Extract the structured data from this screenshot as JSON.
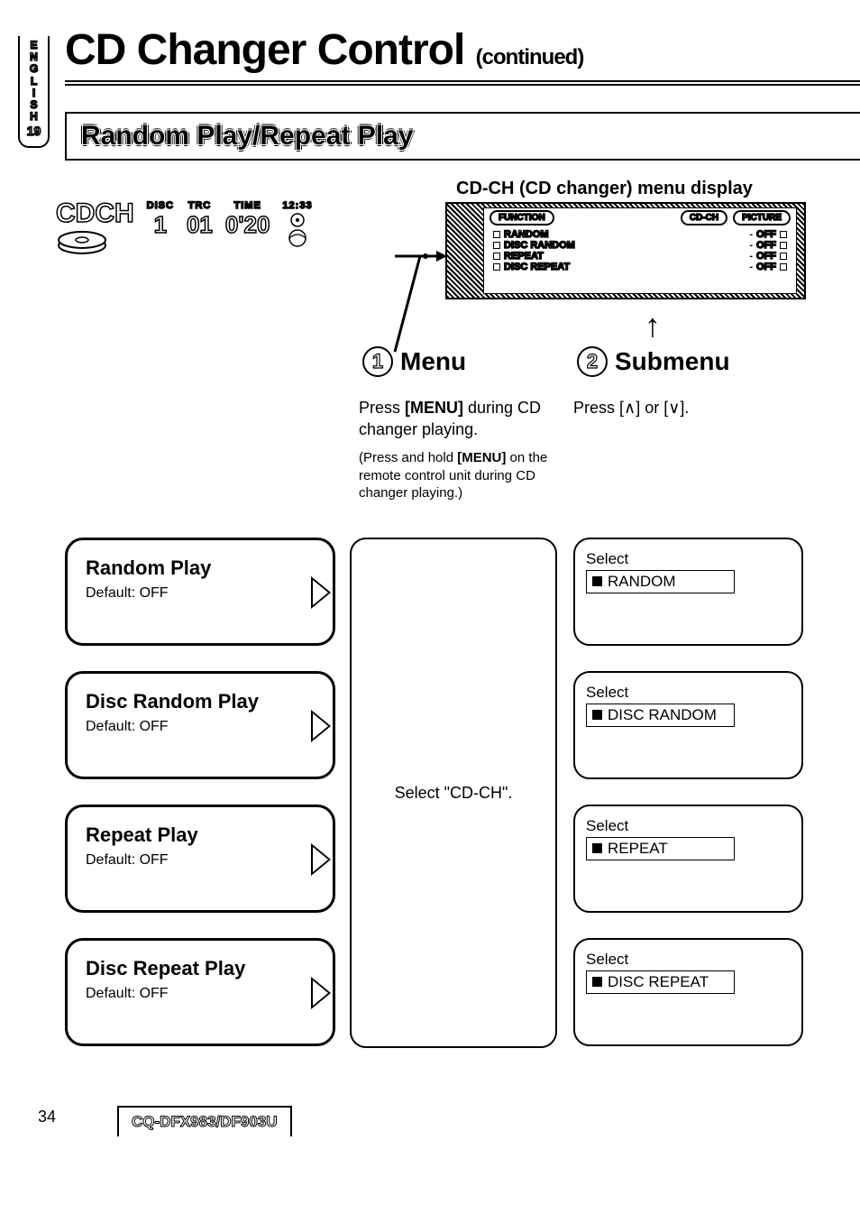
{
  "sidebar": {
    "language": "ENGLISH",
    "page_tab": "19"
  },
  "title": {
    "main": "CD Changer Control",
    "suffix": "(continued)"
  },
  "section": "Random Play/Repeat Play",
  "display": {
    "source": "CDCH",
    "disc_label": "DISC",
    "disc_value": "1",
    "trc_label": "TRC",
    "trc_value": "01",
    "time_label": "TIME",
    "time_value": "0'20",
    "clock": "12:33"
  },
  "menu_display_caption": "CD-CH (CD changer) menu display",
  "menu_screen": {
    "tabs": [
      "FUNCTION",
      "CD-CH",
      "PICTURE"
    ],
    "items": [
      {
        "name": "RANDOM",
        "value": "OFF"
      },
      {
        "name": "DISC RANDOM",
        "value": "OFF"
      },
      {
        "name": "REPEAT",
        "value": "OFF"
      },
      {
        "name": "DISC REPEAT",
        "value": "OFF"
      }
    ]
  },
  "steps": {
    "s1": {
      "num": "1",
      "title": "Menu",
      "text_a": "Press ",
      "text_b": "[MENU]",
      "text_c": " during CD changer playing.",
      "note_a": "(Press and hold ",
      "note_b": "[MENU]",
      "note_c": " on the remote control unit during CD changer playing.)"
    },
    "s2": {
      "num": "2",
      "title": "Submenu",
      "text": "Press [∧] or [∨]."
    }
  },
  "play_options": [
    {
      "title": "Random Play",
      "default": "Default: OFF",
      "select": "RANDOM"
    },
    {
      "title": "Disc Random Play",
      "default": "Default: OFF",
      "select": "DISC RANDOM"
    },
    {
      "title": "Repeat Play",
      "default": "Default: OFF",
      "select": "REPEAT"
    },
    {
      "title": "Disc Repeat Play",
      "default": "Default: OFF",
      "select": "DISC REPEAT"
    }
  ],
  "mid_col_text": "Select \"CD-CH\".",
  "select_label": "Select",
  "footer": {
    "page": "34",
    "model": "CQ-DFX983/DF903U"
  }
}
